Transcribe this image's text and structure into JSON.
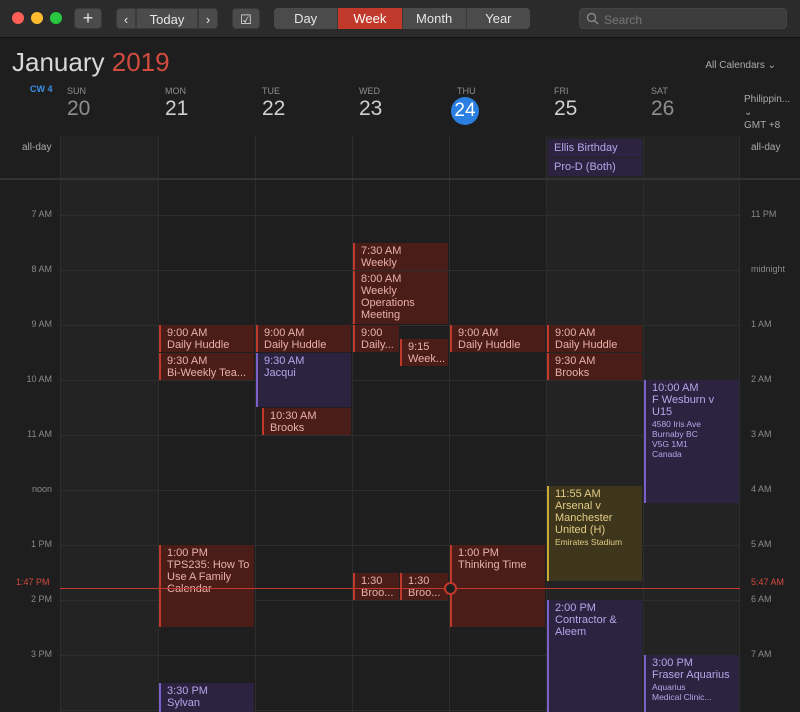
{
  "toolbar": {
    "add_label": "+",
    "prev_label": "‹",
    "today_label": "Today",
    "next_label": "›",
    "check_label": "☑",
    "views": [
      "Day",
      "Week",
      "Month",
      "Year"
    ],
    "active_view": "Week",
    "search_placeholder": "Search"
  },
  "header": {
    "month": "January",
    "year": "2019",
    "all_calendars": "All Calendars ⌄",
    "cw": "CW 4",
    "timezone_line1": "Philippin... ⌄",
    "timezone_line2": "GMT +8"
  },
  "days": [
    {
      "name": "SUN",
      "num": "20"
    },
    {
      "name": "MON",
      "num": "21"
    },
    {
      "name": "TUE",
      "num": "22"
    },
    {
      "name": "WED",
      "num": "23"
    },
    {
      "name": "THU",
      "num": "24"
    },
    {
      "name": "FRI",
      "num": "25"
    },
    {
      "name": "SAT",
      "num": "26"
    }
  ],
  "allday_label": "all-day",
  "allday_events": {
    "ellis": "Ellis Birthday",
    "prod": "Pro-D (Both)"
  },
  "hours_left": [
    "7 AM",
    "8 AM",
    "9 AM",
    "10 AM",
    "11 AM",
    "noon",
    "1 PM",
    "2 PM",
    "3 PM"
  ],
  "hours_right": [
    "11 PM",
    "midnight",
    "1 AM",
    "2 AM",
    "3 AM",
    "4 AM",
    "5 AM",
    "6 AM",
    "7 AM"
  ],
  "now": {
    "left": "1:47 PM",
    "right": "5:47 AM"
  },
  "events": {
    "mon_huddle": {
      "time": "9:00 AM",
      "name": "Daily Huddle"
    },
    "mon_biweekly": {
      "time": "9:30 AM",
      "name": "Bi-Weekly Tea..."
    },
    "mon_tps": {
      "time": "1:00 PM",
      "name": "TPS235: How To Use A Family Calendar"
    },
    "mon_sylvan": {
      "time": "3:30 PM",
      "name": "Sylvan"
    },
    "tue_huddle": {
      "time": "9:00 AM",
      "name": "Daily Huddle"
    },
    "tue_jacqui": {
      "time": "9:30 AM",
      "name": "Jacqui"
    },
    "tue_brooks": {
      "time": "10:30 AM",
      "name": "Brooks Dunca..."
    },
    "wed_custom": {
      "time": "7:30 AM",
      "name": "Weekly Custom..."
    },
    "wed_ops": {
      "time": "8:00 AM",
      "name": "Weekly Operations Meeting"
    },
    "wed_daily": {
      "time": "9:00",
      "name": "Daily..."
    },
    "wed_week": {
      "time": "9:15",
      "name": "Week..."
    },
    "wed_broo1": {
      "time": "1:30",
      "name": "Broo..."
    },
    "wed_broo2": {
      "time": "1:30",
      "name": "Broo..."
    },
    "thu_huddle": {
      "time": "9:00 AM",
      "name": "Daily Huddle"
    },
    "thu_thinking": {
      "time": "1:00 PM",
      "name": "Thinking Time"
    },
    "fri_huddle": {
      "time": "9:00 AM",
      "name": "Daily Huddle"
    },
    "fri_brooks": {
      "time": "9:30 AM",
      "name": "Brooks Duncan..."
    },
    "fri_arsenal": {
      "time": "11:55 AM",
      "name": "Arsenal v Manchester United (H)",
      "sub": "Emirates Stadium"
    },
    "fri_contractor": {
      "time": "2:00 PM",
      "name": "Contractor & Aleem"
    },
    "sat_wesburn": {
      "time": "10:00 AM",
      "name": "F Wesburn v U15",
      "sub1": "4580 Iris Ave",
      "sub2": "Burnaby BC",
      "sub3": "V5G 1M1",
      "sub4": "Canada"
    },
    "sat_fraser": {
      "time": "3:00 PM",
      "name": "Fraser Aquarius",
      "sub1": "Aquarius",
      "sub2": "Medical Clinic..."
    }
  },
  "colors": {
    "accent_red": "#c0392b",
    "today_blue": "#2a7fe0",
    "purple": "#7a60c8",
    "yellow": "#c9a934"
  }
}
